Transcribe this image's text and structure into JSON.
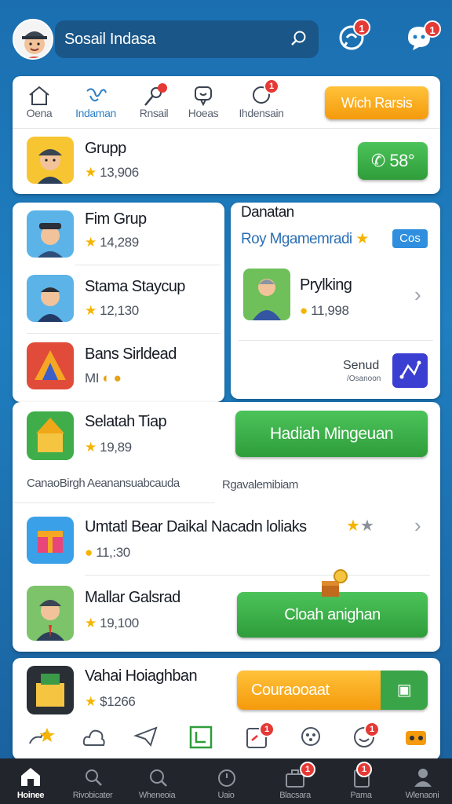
{
  "header": {
    "search_text": "Sosail Indasa",
    "chat_badge": "1",
    "bot_badge": "1"
  },
  "tabs": [
    {
      "label": "Oena",
      "icon": "home-icon"
    },
    {
      "label": "Indaman",
      "icon": "share-icon"
    },
    {
      "label": "Rnsail",
      "icon": "microphone-icon"
    },
    {
      "label": "Hoeas",
      "icon": "message-icon"
    },
    {
      "label": "Ihdensain",
      "icon": "chat-bubble-icon",
      "badge": "1"
    }
  ],
  "tab_action_label": "Wich Rarsis",
  "grup": {
    "name": "Grupp",
    "stat": "13,906",
    "button": "58°"
  },
  "left_list": [
    {
      "name": "Fim Grup",
      "stat": "14,289"
    },
    {
      "name": "Stama Staycup",
      "stat": "12,130"
    },
    {
      "name": "Bans Sirldead",
      "stat": "MI"
    }
  ],
  "right_panel": {
    "title": "Danatan",
    "subtitle": "Roy Mgamemradi",
    "tag": "Cos",
    "item_name": "Prylking",
    "item_stat": "11,998",
    "footer_title": "Senud",
    "footer_sub": "/Osanoon"
  },
  "selasih": {
    "name": "Selatah Tiap",
    "stat": "19,89",
    "button": "Hadiah Mingeuan"
  },
  "section_labels": {
    "left": "CanaoBirgh Aeanansuabcauda",
    "right": "Rgavalemibiam"
  },
  "umtat": {
    "name": "Umtatl Bear Daikal Nacadn loliaks",
    "stat": "11,:30"
  },
  "mallar": {
    "name": "Mallar Galsrad",
    "stat": "19,100",
    "button": "Cloah anighan"
  },
  "vahai": {
    "name": "Vahai Hoiaghban",
    "stat": "$1266",
    "button": "Couraooaat"
  },
  "icon_row": [
    {
      "icon": "star-puzzle-icon"
    },
    {
      "icon": "cloud-icon"
    },
    {
      "icon": "send-icon"
    },
    {
      "icon": "frame-icon"
    },
    {
      "icon": "note-icon",
      "badge": "1"
    },
    {
      "icon": "settings-cloud-icon"
    },
    {
      "icon": "smile-icon",
      "badge": "1"
    },
    {
      "icon": "game-icon"
    }
  ],
  "bottom_nav": [
    {
      "label": "Hoinee",
      "active": true
    },
    {
      "label": "Rivobicater"
    },
    {
      "label": "Wheneoia"
    },
    {
      "label": "Uaio"
    },
    {
      "label": "Blacsara",
      "badge": "1"
    },
    {
      "label": "Pama",
      "badge": "1"
    },
    {
      "label": "Wlenaoni"
    }
  ],
  "colors": {
    "accent_green": "#2e9d3a",
    "accent_orange": "#f59a0c",
    "brand_blue": "#1f7fc0",
    "badge_red": "#e53935"
  }
}
